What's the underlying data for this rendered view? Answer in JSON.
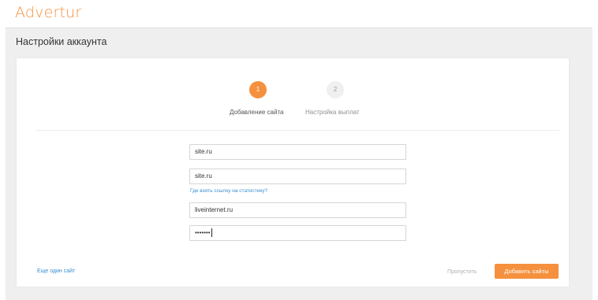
{
  "app": {
    "brand": "Advertur"
  },
  "page": {
    "title": "Настройки аккаунта"
  },
  "steps": [
    {
      "number": "1",
      "label": "Добавление сайта",
      "active": true
    },
    {
      "number": "2",
      "label": "Настройка выплат",
      "active": false
    }
  ],
  "form": {
    "site_url_value": "site.ru",
    "stats_site_value": "site.ru",
    "stats_help_link": "Где взять ссылку на статистику?",
    "counter_value": "liveinternet.ru",
    "password_value": "•••••••"
  },
  "actions": {
    "add_another": "Еще один сайт",
    "skip": "Пропустить",
    "submit": "Добавить сайты"
  },
  "colors": {
    "accent": "#f5913e",
    "link": "#3a8fd0",
    "page_bg": "#efefef"
  }
}
